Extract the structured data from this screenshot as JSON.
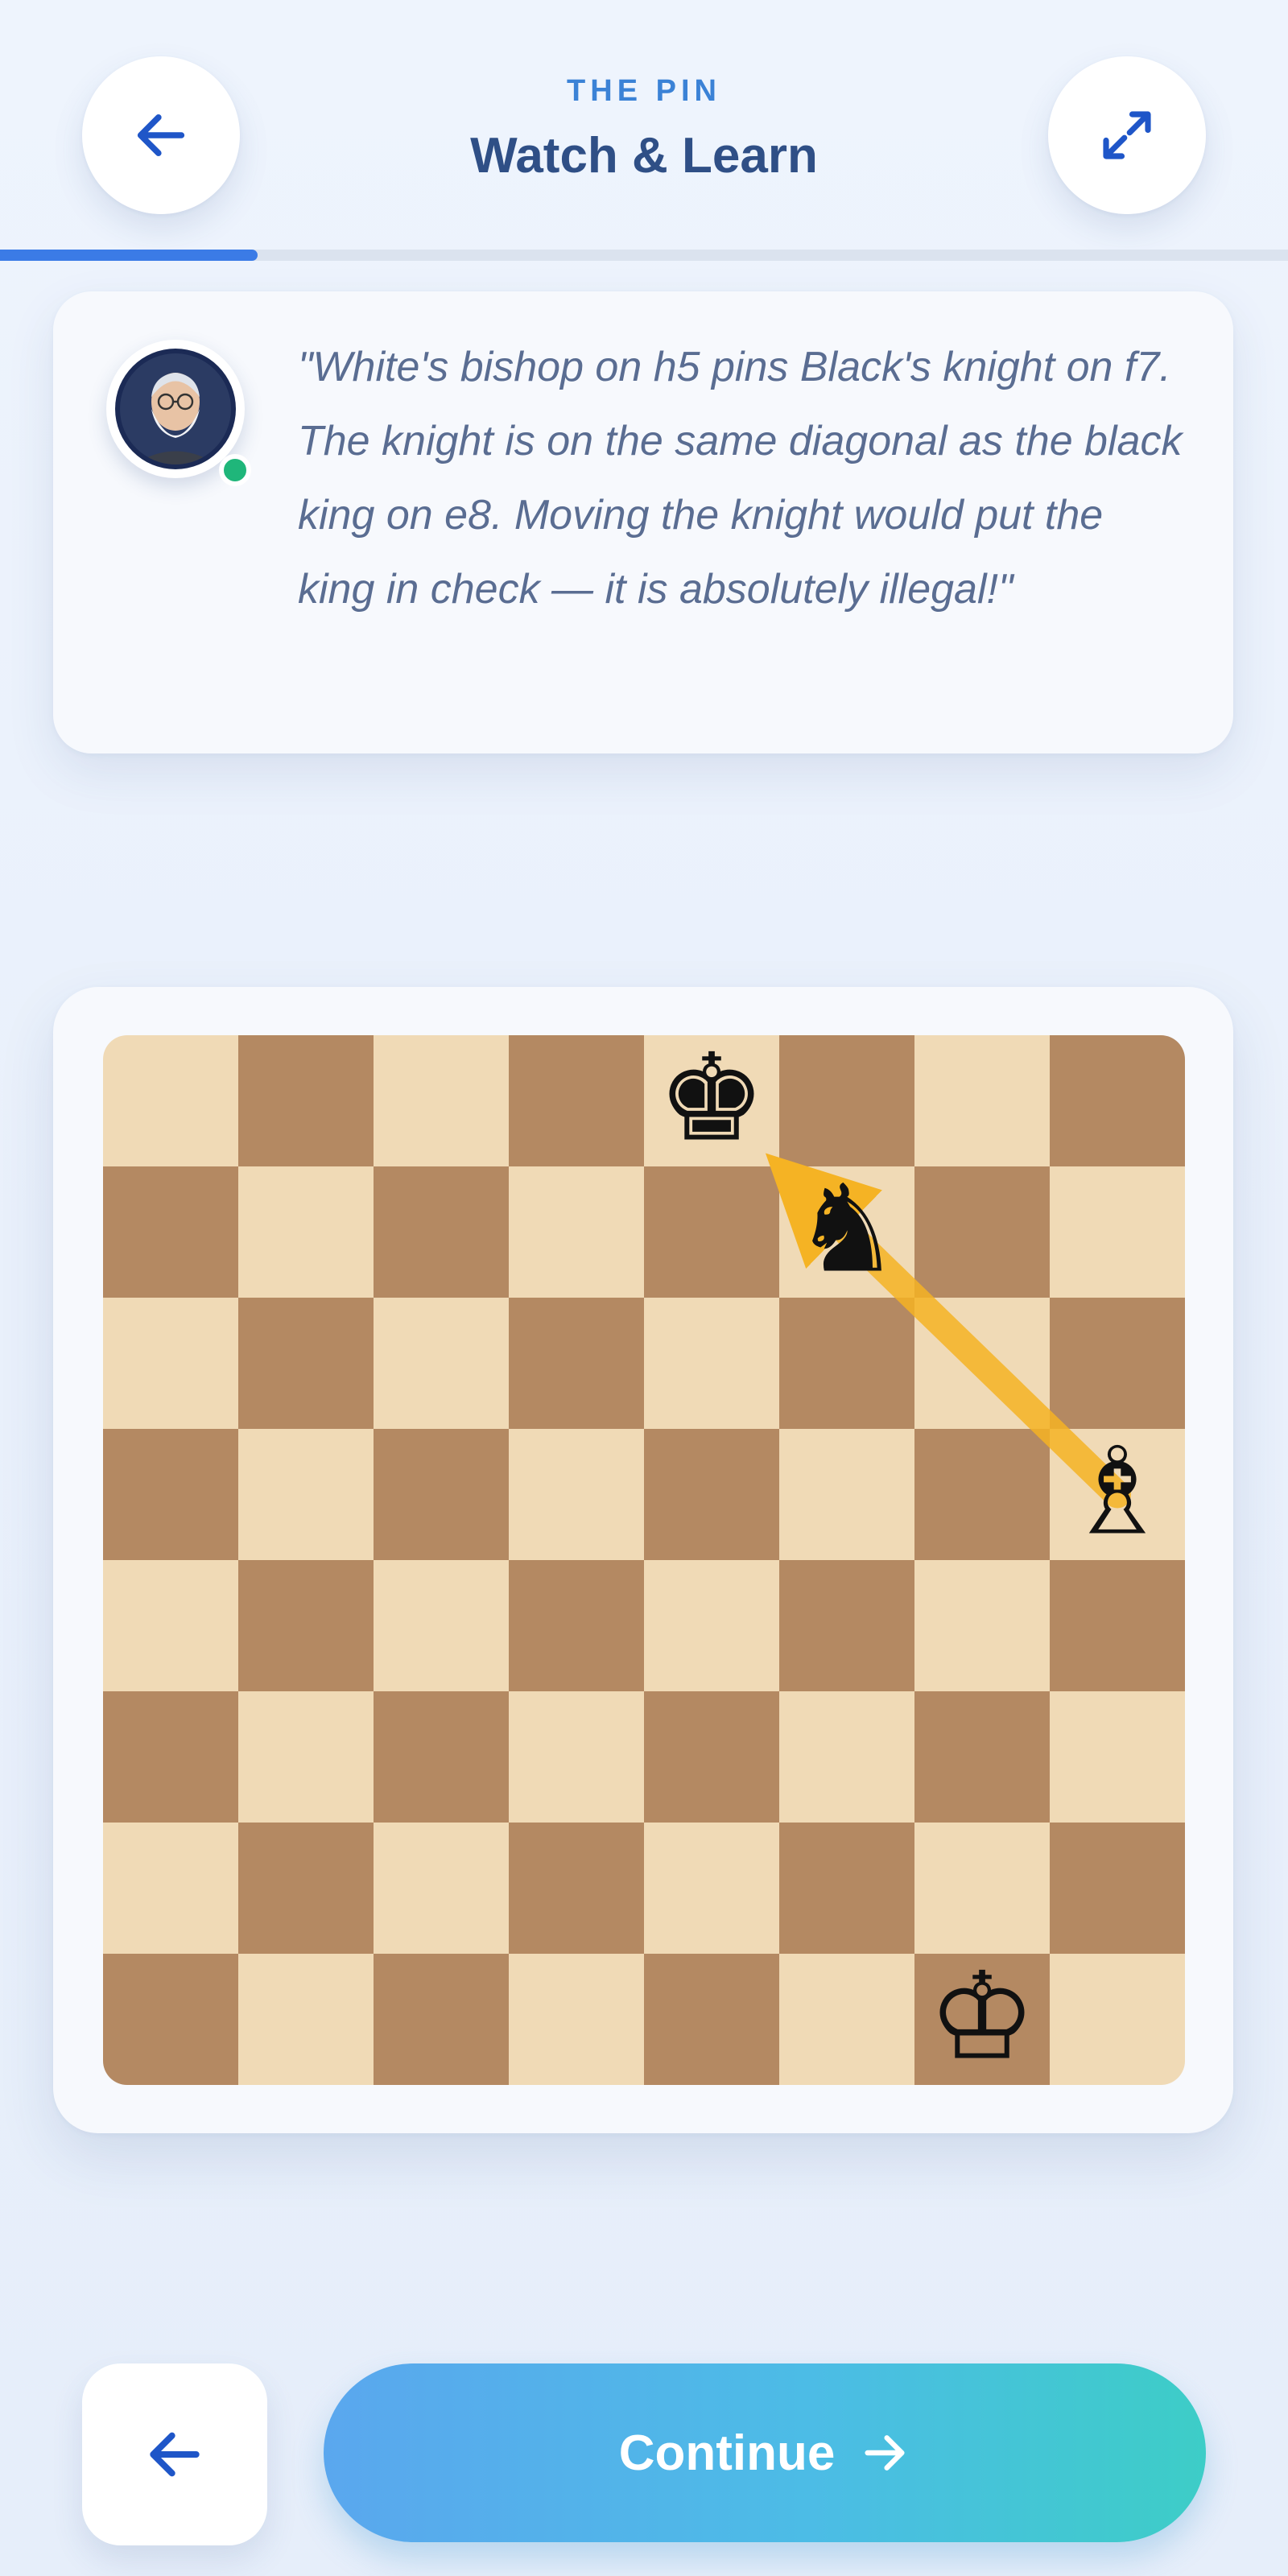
{
  "header": {
    "eyebrow": "THE PIN",
    "title": "Watch & Learn",
    "back_icon": "arrow-left-icon",
    "expand_icon": "expand-diagonal-icon"
  },
  "progress": {
    "fraction": 0.2,
    "color": "#3b7be6"
  },
  "coach": {
    "avatar_icon": "coach-avatar-icon",
    "status": "online",
    "message": "\"White's bishop on h5 pins Black's knight on f7. The knight is on the same diagonal as the black king on e8. Moving the knight would put the king in check — it is absolutely illegal!\""
  },
  "board": {
    "light_color": "#f0dab6",
    "dark_color": "#b48962",
    "pieces": [
      {
        "square": "e8",
        "piece": "black-king-icon",
        "glyph": "♚"
      },
      {
        "square": "f7",
        "piece": "black-knight-icon",
        "glyph": "♞"
      },
      {
        "square": "h5",
        "piece": "white-bishop-icon",
        "glyph": "♗"
      },
      {
        "square": "g1",
        "piece": "white-king-icon",
        "glyph": "♔"
      }
    ],
    "arrow": {
      "from": "h5",
      "to": "e8",
      "color": "#f5b324"
    }
  },
  "footer": {
    "back_icon": "arrow-left-icon",
    "continue_label": "Continue",
    "continue_icon": "arrow-right-icon"
  }
}
